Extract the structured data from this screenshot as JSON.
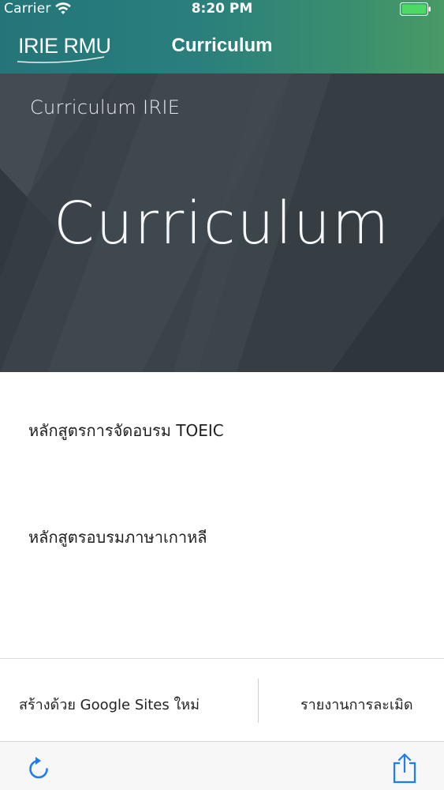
{
  "status_bar": {
    "carrier": "Carrier",
    "time": "8:20 PM",
    "wifi_icon": "wifi-icon",
    "battery_icon": "battery-full-icon"
  },
  "nav_bar": {
    "logo_text": "IRIE RMU",
    "title": "Curriculum"
  },
  "hero": {
    "site_name": "Curriculum IRIE",
    "page_heading": "Curriculum"
  },
  "courses": [
    {
      "label": "หลักสูตรการจัดอบรม TOEIC"
    },
    {
      "label": "หลักสูตรอบรมภาษาเกาหลี"
    }
  ],
  "footer": {
    "left_link": "สร้างด้วย Google Sites ใหม่",
    "right_link": "รายงานการละเมิด"
  },
  "toolbar": {
    "refresh_icon": "refresh-icon",
    "share_icon": "share-icon"
  },
  "colors": {
    "accent_start": "#247579",
    "accent_end": "#4a9a66",
    "ios_blue": "#1b7cf5",
    "hero_bg": "#3a4249"
  }
}
